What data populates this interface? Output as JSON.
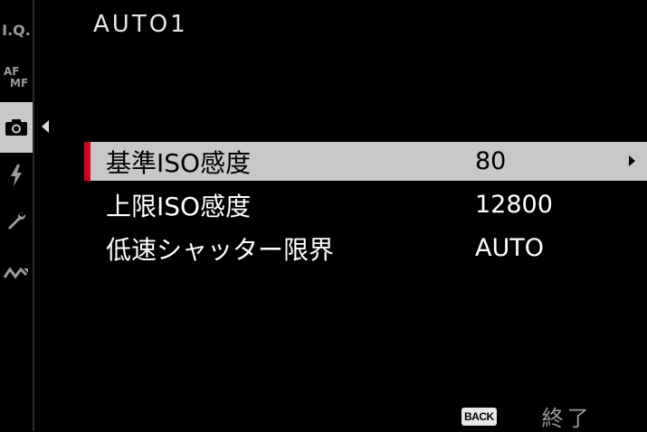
{
  "sidebar": {
    "iq_label": "I.Q.",
    "af_label": "AF",
    "mf_label": "MF",
    "items": [
      {
        "icon": "image-quality-icon"
      },
      {
        "icon": "af-mf-icon"
      },
      {
        "icon": "camera-icon",
        "selected": true
      },
      {
        "icon": "flash-icon"
      },
      {
        "icon": "wrench-icon"
      },
      {
        "icon": "connection-icon"
      }
    ]
  },
  "header": {
    "title": "AUTO1"
  },
  "menu": {
    "rows": [
      {
        "label": "基準ISO感度",
        "value": "80"
      },
      {
        "label": "上限ISO感度",
        "value": "12800"
      },
      {
        "label": "低速シャッター限界",
        "value": "AUTO"
      }
    ]
  },
  "footer": {
    "back_badge": "BACK",
    "exit_label": "終了"
  },
  "colors": {
    "background": "#000000",
    "selected_row": "#c8c8c8",
    "accent_marker": "#d8001a",
    "sidebar_selected": "#c9c9c9",
    "muted_text": "#9a9a9a"
  }
}
